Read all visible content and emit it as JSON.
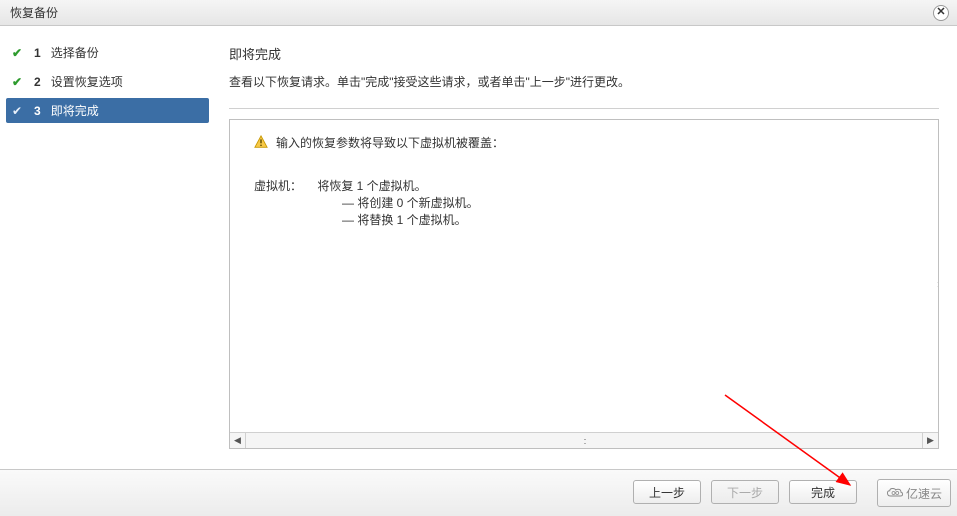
{
  "window": {
    "title": "恢复备份"
  },
  "steps": [
    {
      "num": "1",
      "label": "选择备份",
      "status": "complete"
    },
    {
      "num": "2",
      "label": "设置恢复选项",
      "status": "complete"
    },
    {
      "num": "3",
      "label": "即将完成",
      "status": "active"
    }
  ],
  "main": {
    "heading": "即将完成",
    "subheading": "查看以下恢复请求。单击\"完成\"接受这些请求，或者单击\"上一步\"进行更改。",
    "warning": "输入的恢复参数将导致以下虚拟机被覆盖：",
    "vm_section_label": "虚拟机：",
    "vm_summary": "将恢复 1 个虚拟机。",
    "vm_line1_prefix": "— ",
    "vm_line1": "将创建 0 个新虚拟机。",
    "vm_line2_prefix": "— ",
    "vm_line2": "将替换 1 个虚拟机。"
  },
  "footer": {
    "back": "上一步",
    "next": "下一步",
    "finish": "完成",
    "brand": "亿速云"
  }
}
